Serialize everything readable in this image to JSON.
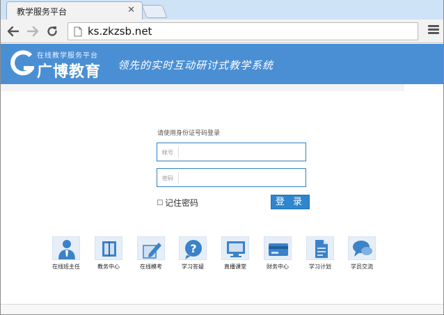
{
  "browser": {
    "tab_title": "教学服务平台",
    "url": "ks.zkzsb.net"
  },
  "header": {
    "logo_small": "在线教学服务平台",
    "logo_main": "广博教育",
    "slogan": "领先的实时互动研讨式教学系统"
  },
  "login": {
    "hint": "请使用身份证号码登录",
    "account_label": "帐号",
    "account_value": "",
    "password_label": "密码",
    "password_value": "",
    "remember_label": "记住密码",
    "submit_label": "登 录"
  },
  "quick_links": [
    {
      "label": "在线班主任",
      "icon": "teacher-icon"
    },
    {
      "label": "教务中心",
      "icon": "book-icon"
    },
    {
      "label": "在线模考",
      "icon": "pencil-icon"
    },
    {
      "label": "学习答疑",
      "icon": "question-icon"
    },
    {
      "label": "直播课堂",
      "icon": "monitor-icon"
    },
    {
      "label": "财务中心",
      "icon": "card-icon"
    },
    {
      "label": "学习计划",
      "icon": "document-icon"
    },
    {
      "label": "学员交流",
      "icon": "chat-icon"
    }
  ],
  "colors": {
    "banner": "#4a8fd4",
    "button": "#2f86cf",
    "field_border": "#2c7ec0"
  }
}
